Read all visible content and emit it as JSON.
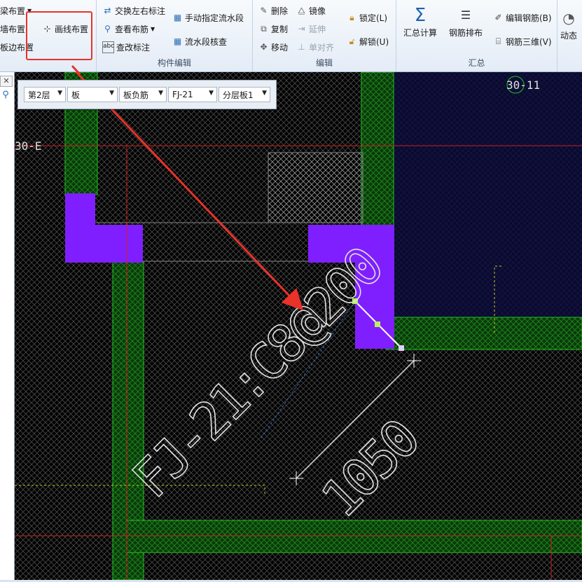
{
  "ribbon": {
    "group1": {
      "beam_layout": "梁布置",
      "wall_layout": "墙布置",
      "slab_edge_layout": "板边布置",
      "draw_line_layout": "画线布置"
    },
    "group_component_edit": {
      "label": "构件编辑",
      "swap_labels": "交换左右标注",
      "view_rebar": "查看布筋",
      "edit_label": "查改标注",
      "manual_flow": "手动指定流水段",
      "flow_check": "流水段核查"
    },
    "group_edit": {
      "label": "编辑",
      "delete": "删除",
      "mirror": "镜像",
      "copy": "复制",
      "extend": "延伸",
      "move": "移动",
      "single_align": "单对齐",
      "lock": "锁定(L)",
      "unlock": "解锁(U)"
    },
    "group_summary": {
      "label": "汇总",
      "sum_calc": "汇总计算",
      "rebar_arrange": "钢筋排布",
      "edit_rebar": "编辑钢筋(B)",
      "rebar_3d": "钢筋三维(V)",
      "dynamic": "动态"
    }
  },
  "floatbar": {
    "floor": "第2层",
    "component_type": "板",
    "sub_type": "板负筋",
    "component_name": "FJ-21",
    "layer": "分层板1"
  },
  "canvas": {
    "axis_top_right": "30-11",
    "axis_left": "30-E",
    "rebar_label": "FJ-21:C8@200",
    "dimension_label": "1050"
  },
  "colors": {
    "highlight_box": "#e8322a",
    "arrow": "#e8322a",
    "wall_fill": "#7f1fff",
    "grid_green": "#22c022",
    "axis_red": "#cc2020",
    "canvas_bg": "#000000",
    "slab_blue": "#0a0a30"
  }
}
